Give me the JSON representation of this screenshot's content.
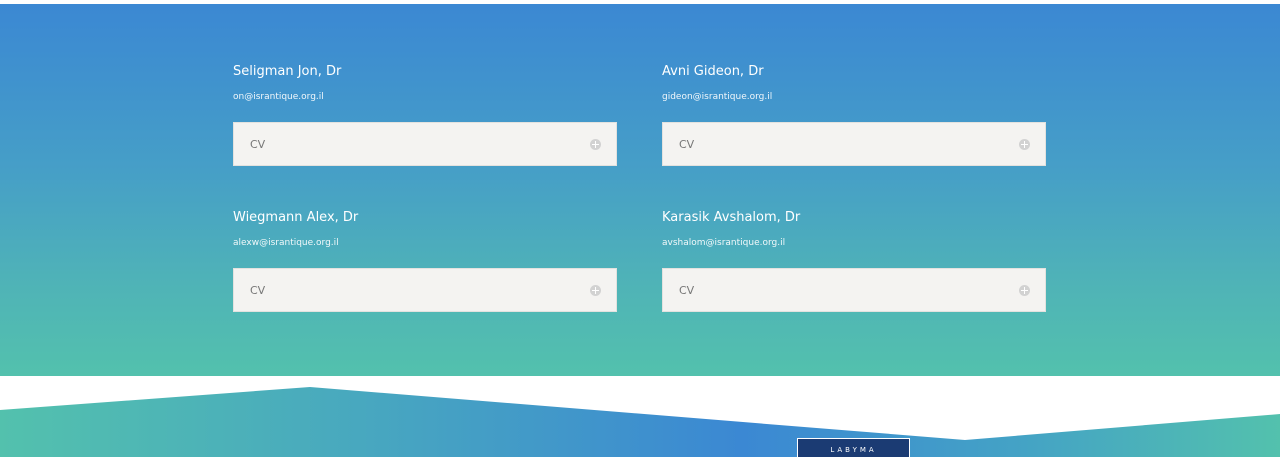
{
  "team": {
    "members": [
      {
        "name": "Seligman Jon, Dr",
        "email": "on@israntique.org.il",
        "cv_label": "CV"
      },
      {
        "name": "Avni Gideon, Dr",
        "email": "gideon@israntique.org.il",
        "cv_label": "CV"
      },
      {
        "name": "Wiegmann Alex, Dr",
        "email": "alexw@israntique.org.il",
        "cv_label": "CV"
      },
      {
        "name": "Karasik Avshalom, Dr",
        "email": "avshalom@israntique.org.il",
        "cv_label": "CV"
      }
    ]
  },
  "footer": {
    "logo_text": "LABYMA"
  },
  "colors": {
    "gradient_top": "#3b88d3",
    "gradient_bottom": "#53c1ad",
    "cv_panel_background": "#f4f3f1",
    "footer_logo_background": "#1b3b73"
  },
  "icons": {
    "cv_toggle": "plus-circle-icon"
  }
}
